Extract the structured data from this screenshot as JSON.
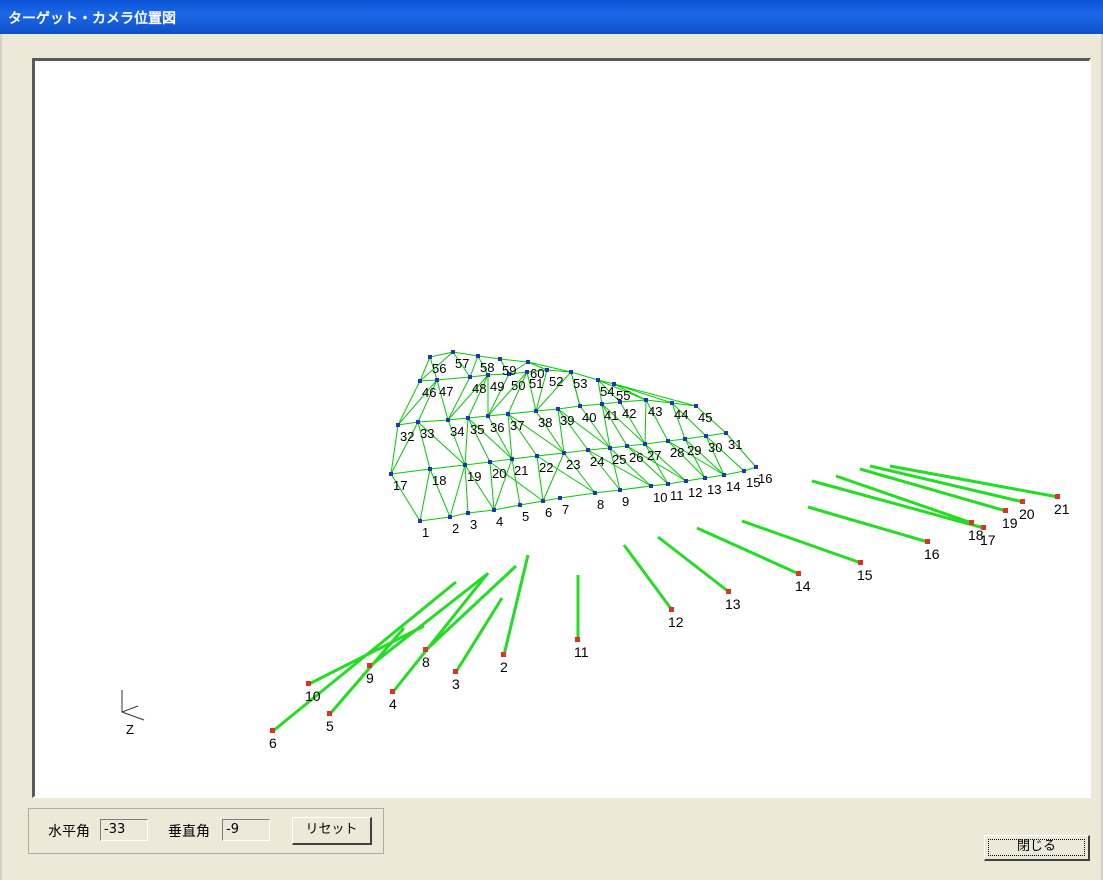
{
  "window": {
    "title": "ターゲット・カメラ位置図"
  },
  "scene": {
    "targets": [
      "1",
      "2",
      "3",
      "4",
      "5",
      "6",
      "7",
      "8",
      "9",
      "10",
      "11",
      "12",
      "13",
      "14",
      "15",
      "16",
      "17",
      "18",
      "19",
      "20",
      "21",
      "22",
      "23",
      "24",
      "25",
      "26",
      "27",
      "28",
      "29",
      "30",
      "31",
      "32",
      "33",
      "34",
      "35",
      "36",
      "37",
      "38",
      "39",
      "40",
      "41",
      "42",
      "43",
      "44",
      "45",
      "46",
      "47",
      "48",
      "49",
      "50",
      "51",
      "52",
      "53",
      "54",
      "55",
      "56",
      "57",
      "58",
      "59",
      "60"
    ],
    "cameras": [
      "2",
      "3",
      "4",
      "5",
      "6",
      "8",
      "9",
      "10",
      "11",
      "12",
      "13",
      "14",
      "15",
      "16",
      "17",
      "18",
      "19",
      "20",
      "21"
    ],
    "axis_label": "Z",
    "colors": {
      "frame": "#00cc00",
      "target": "#2233bb",
      "camera": "#dd3322",
      "ray": "#22dd22",
      "label": "#000000"
    }
  },
  "controls": {
    "horizontal_label": "水平角",
    "horizontal_value": "-33",
    "vertical_label": "垂直角",
    "vertical_value": "-9",
    "reset_label": "リセット",
    "close_label": "閉じる"
  }
}
